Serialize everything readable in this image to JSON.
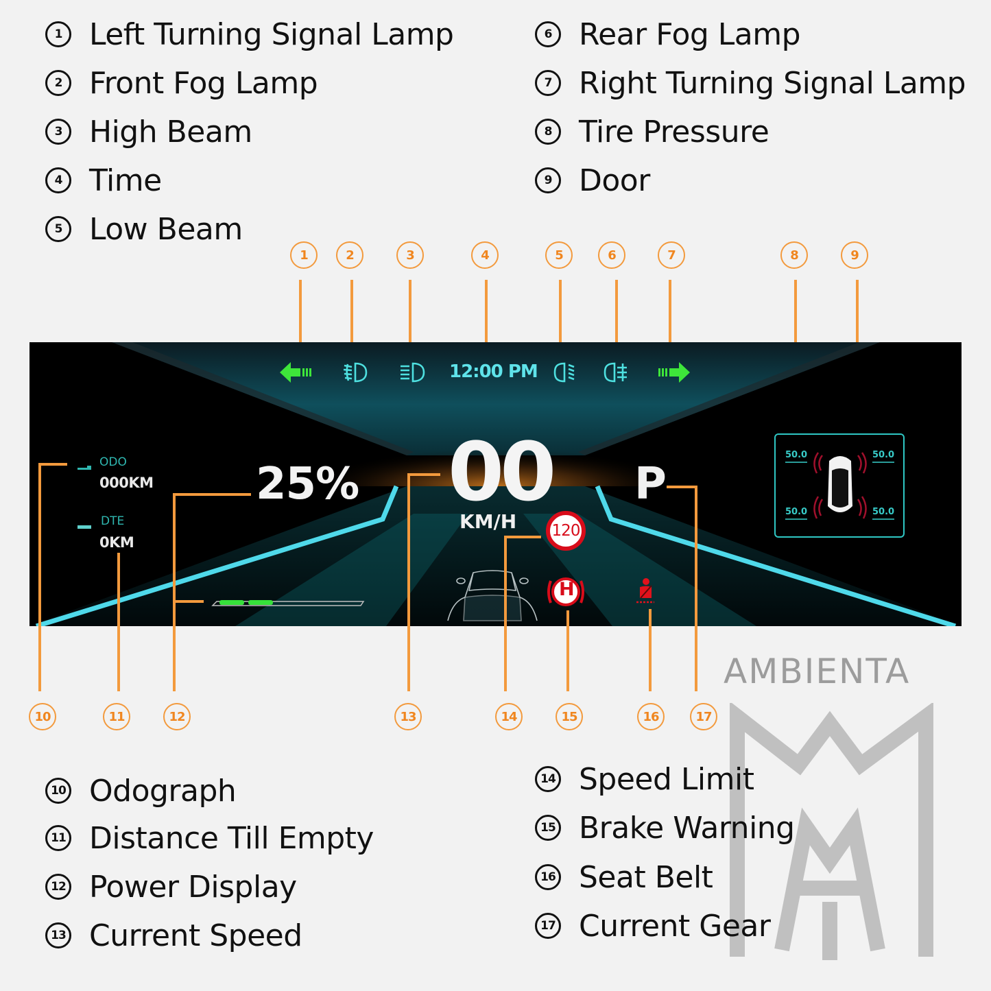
{
  "legend_top_left": [
    {
      "num": "1",
      "label": "Left Turning Signal Lamp"
    },
    {
      "num": "2",
      "label": "Front Fog Lamp"
    },
    {
      "num": "3",
      "label": "High Beam"
    },
    {
      "num": "4",
      "label": "Time"
    },
    {
      "num": "5",
      "label": "Low Beam"
    }
  ],
  "legend_top_right": [
    {
      "num": "6",
      "label": "Rear Fog Lamp"
    },
    {
      "num": "7",
      "label": "Right Turning Signal Lamp"
    },
    {
      "num": "8",
      "label": "Tire Pressure"
    },
    {
      "num": "9",
      "label": "Door"
    }
  ],
  "legend_bottom_left": [
    {
      "num": "10",
      "label": "Odograph"
    },
    {
      "num": "11",
      "label": "Distance Till Empty"
    },
    {
      "num": "12",
      "label": "Power Display"
    },
    {
      "num": "13",
      "label": "Current Speed"
    }
  ],
  "legend_bottom_right": [
    {
      "num": "14",
      "label": "Speed Limit"
    },
    {
      "num": "15",
      "label": "Brake Warning"
    },
    {
      "num": "16",
      "label": "Seat Belt"
    },
    {
      "num": "17",
      "label": "Current Gear"
    }
  ],
  "callouts_top": [
    "1",
    "2",
    "3",
    "4",
    "5",
    "6",
    "7",
    "8",
    "9"
  ],
  "callouts_bottom": [
    "10",
    "11",
    "12",
    "13",
    "14",
    "15",
    "16",
    "17"
  ],
  "dashboard": {
    "icons": {
      "left_turn": "left-turn-signal-icon",
      "front_fog": "front-fog-lamp-icon",
      "high_beam": "high-beam-icon",
      "low_beam": "low-beam-icon",
      "rear_fog": "rear-fog-lamp-icon",
      "right_turn": "right-turn-signal-icon"
    },
    "time": "12:00 PM",
    "odo_label": "ODO",
    "odo_value": "000KM",
    "dte_label": "DTE",
    "dte_value": "0KM",
    "power_percent_text": "25%",
    "power_bar_fraction": 0.38,
    "speed": "00",
    "speed_unit": "KM/H",
    "speed_limit": "120",
    "brake_label": "H",
    "gear": "P",
    "tire_pressures": {
      "front_left": "50.0",
      "front_right": "50.0",
      "rear_left": "50.0",
      "rear_right": "50.0"
    }
  },
  "colors": {
    "callout": "#f39a3d",
    "turn_signal": "#3ee53a",
    "indicator_cyan": "#4ee0e0",
    "warning_red": "#d80c1a",
    "lane_cyan": "#4fd9ea"
  },
  "watermark": {
    "brand": "AMBIENTA"
  }
}
